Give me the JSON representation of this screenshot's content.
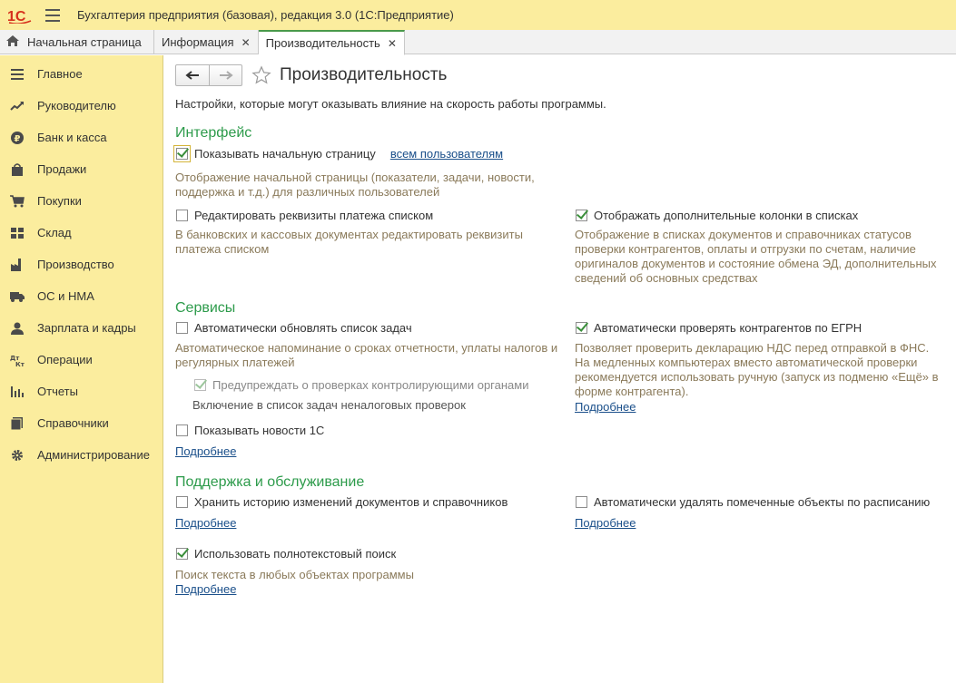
{
  "app": {
    "title": "Бухгалтерия предприятия (базовая), редакция 3.0  (1С:Предприятие)"
  },
  "tabs": {
    "home": "Начальная страница",
    "info": "Информация",
    "perf": "Производительность",
    "close_glyph": "✕"
  },
  "sidebar": {
    "items": [
      {
        "label": "Главное",
        "icon": "list-icon"
      },
      {
        "label": "Руководителю",
        "icon": "trend-icon"
      },
      {
        "label": "Банк и касса",
        "icon": "ruble-icon"
      },
      {
        "label": "Продажи",
        "icon": "bag-icon"
      },
      {
        "label": "Покупки",
        "icon": "cart-icon"
      },
      {
        "label": "Склад",
        "icon": "grid-icon"
      },
      {
        "label": "Производство",
        "icon": "factory-icon"
      },
      {
        "label": "ОС и НМА",
        "icon": "truck-icon"
      },
      {
        "label": "Зарплата и кадры",
        "icon": "person-icon"
      },
      {
        "label": "Операции",
        "icon": "dt-kt-icon"
      },
      {
        "label": "Отчеты",
        "icon": "bar-chart-icon"
      },
      {
        "label": "Справочники",
        "icon": "books-icon"
      },
      {
        "label": "Администрирование",
        "icon": "gear-icon"
      }
    ]
  },
  "page": {
    "title": "Производительность",
    "intro": "Настройки, которые могут оказывать влияние на скорость работы программы.",
    "more": "Подробнее"
  },
  "interface": {
    "title": "Интерфейс",
    "show_home": {
      "label": "Показывать начальную страницу",
      "checked": true,
      "link": "всем пользователям",
      "desc1": "Отображение начальной страницы (показатели, задачи, новости,",
      "desc2": "поддержка и т.д.) для различных пользователей"
    },
    "edit_payment": {
      "label": "Редактировать реквизиты платежа списком",
      "checked": false,
      "desc1": "В банковских и кассовых документах редактировать реквизиты",
      "desc2": "платежа списком"
    },
    "extra_columns": {
      "label": "Отображать дополнительные колонки в списках",
      "checked": true,
      "desc1": "Отображение в списках документов и справочниках статусов",
      "desc2": "проверки контрагентов, оплаты и отгрузки по счетам, наличие",
      "desc3": "оригиналов документов и состояние обмена ЭД, дополнительных",
      "desc4": "сведений об основных средствах"
    }
  },
  "services": {
    "title": "Сервисы",
    "auto_tasks": {
      "label": "Автоматически обновлять список задач",
      "checked": false,
      "desc1": "Автоматическое напоминание о сроках отчетности, уплаты налогов и",
      "desc2": "регулярных платежей"
    },
    "warn_checks": {
      "label": "Предупреждать о проверках контролирующими органами",
      "checked": true,
      "desc": "Включение в список задач неналоговых проверок"
    },
    "news": {
      "label": "Показывать новости 1С",
      "checked": false
    },
    "egrn": {
      "label": "Автоматически проверять контрагентов по ЕГРН",
      "checked": true,
      "desc1": "Позволяет проверить декларацию НДС перед отправкой в ФНС.",
      "desc2": "На медленных компьютерах вместо автоматической проверки",
      "desc3": "рекомендуется использовать ручную (запуск из подменю «Ещё» в",
      "desc4": "форме контрагента)."
    }
  },
  "support": {
    "title": "Поддержка и обслуживание",
    "history": {
      "label": "Хранить историю изменений документов и справочников",
      "checked": false
    },
    "auto_delete": {
      "label": "Автоматически удалять помеченные объекты по расписанию",
      "checked": false
    },
    "fulltext": {
      "label": "Использовать полнотекстовый поиск",
      "checked": true,
      "desc": "Поиск текста в любых объектах программы"
    }
  },
  "colors": {
    "sidebar_bg": "#fbed9e",
    "section_title": "#2d9b4b",
    "link": "#1a4f8a",
    "description": "#8a7a5a"
  }
}
